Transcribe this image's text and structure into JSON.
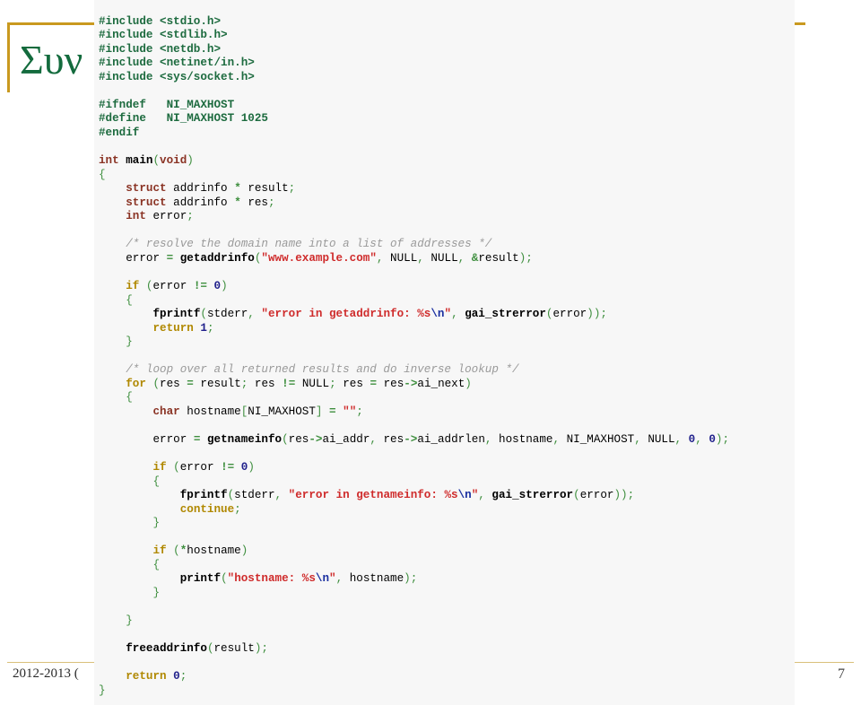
{
  "slide": {
    "title": "Συν",
    "title_color": "#136b3d",
    "accent_color": "#c9991f",
    "page_number": "7",
    "footer_text": "2012-2013 ("
  },
  "code": {
    "language": "c",
    "panel_background": "#f7f7f7",
    "lines": [
      "#include <stdio.h>",
      "#include <stdlib.h>",
      "#include <netdb.h>",
      "#include <netinet/in.h>",
      "#include <sys/socket.h>",
      "",
      "#ifndef   NI_MAXHOST",
      "#define   NI_MAXHOST 1025",
      "#endif",
      "",
      "int main(void)",
      "{",
      "    struct addrinfo * result;",
      "    struct addrinfo * res;",
      "    int error;",
      "",
      "    /* resolve the domain name into a list of addresses */",
      "    error = getaddrinfo(\"www.example.com\", NULL, NULL, &result);",
      "",
      "    if (error != 0)",
      "    {",
      "        fprintf(stderr, \"error in getaddrinfo: %s\\n\", gai_strerror(error));",
      "        return 1;",
      "    }",
      "",
      "    /* loop over all returned results and do inverse lookup */",
      "    for (res = result; res != NULL; res = res->ai_next)",
      "    {",
      "        char hostname[NI_MAXHOST] = \"\";",
      "",
      "        error = getnameinfo(res->ai_addr, res->ai_addrlen, hostname, NI_MAXHOST, NULL, 0, 0);",
      "",
      "        if (error != 0)",
      "        {",
      "            fprintf(stderr, \"error in getnameinfo: %s\\n\", gai_strerror(error));",
      "            continue;",
      "        }",
      "",
      "        if (*hostname)",
      "        {",
      "            printf(\"hostname: %s\\n\", hostname);",
      "        }",
      "",
      "    }",
      "",
      "    freeaddrinfo(result);",
      "",
      "    return 0;",
      "}"
    ]
  }
}
